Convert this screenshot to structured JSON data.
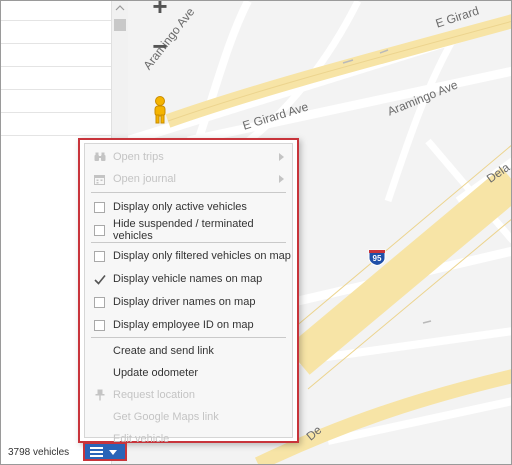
{
  "map": {
    "streets": [
      {
        "id": "aramingo-top",
        "text": "Aramingo Ave"
      },
      {
        "id": "e-girard-right",
        "text": "E Girard"
      },
      {
        "id": "e-girard-center",
        "text": "E Girard Ave"
      },
      {
        "id": "aramingo-right",
        "text": "Aramingo Ave"
      },
      {
        "id": "delaware",
        "text": "Dela"
      },
      {
        "id": "de-bottom",
        "text": "De"
      }
    ],
    "highway_shield": "95",
    "zoom_in_label": "+",
    "zoom_out_label": "−",
    "road_color": "#f7e4a6",
    "background_color": "#f3f3f3"
  },
  "context_menu": {
    "items": [
      {
        "label": "Open trips",
        "icon": "binoculars-icon",
        "enabled": false,
        "submenu": true
      },
      {
        "label": "Open journal",
        "icon": "calendar-icon",
        "enabled": false,
        "submenu": true
      },
      {
        "label": "Display only active vehicles",
        "type": "checkbox",
        "checked": false,
        "enabled": true
      },
      {
        "label": "Hide suspended / terminated vehicles",
        "type": "checkbox",
        "checked": false,
        "enabled": true
      },
      {
        "label": "Display only filtered vehicles on map",
        "type": "checkbox",
        "checked": false,
        "enabled": true
      },
      {
        "label": "Display vehicle names on map",
        "type": "checkbox",
        "checked": true,
        "enabled": true
      },
      {
        "label": "Display driver names on map",
        "type": "checkbox",
        "checked": false,
        "enabled": true
      },
      {
        "label": "Display employee ID on map",
        "type": "checkbox",
        "checked": false,
        "enabled": true
      },
      {
        "label": "Create and send link",
        "enabled": true
      },
      {
        "label": "Update odometer",
        "enabled": true
      },
      {
        "label": "Request location",
        "icon": "pin-icon",
        "enabled": false
      },
      {
        "label": "Get Google Maps link",
        "enabled": false
      },
      {
        "label": "Edit vehicle",
        "enabled": false
      }
    ]
  },
  "bottom_bar": {
    "vehicle_count": "3798 vehicles"
  },
  "colors": {
    "highlight_border": "#c8343b",
    "toggle_button": "#2a64b8",
    "disabled_text": "#c4c4c4"
  }
}
